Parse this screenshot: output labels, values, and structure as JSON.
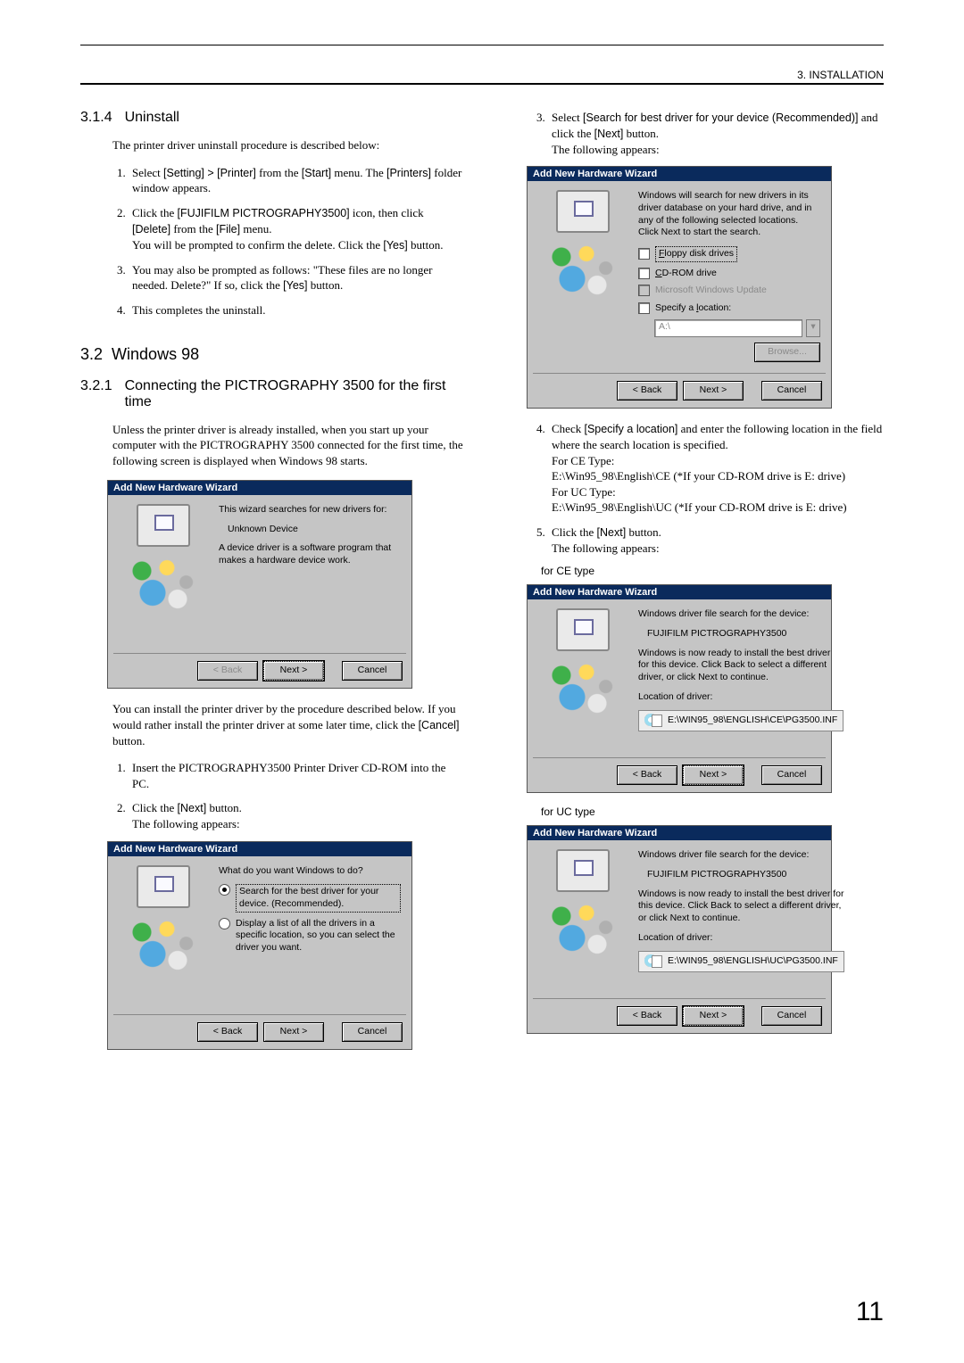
{
  "header": {
    "chapter": "3. INSTALLATION"
  },
  "page_number": "11",
  "left": {
    "sec314": {
      "num": "3.1.4",
      "title": "Uninstall",
      "intro": "The printer driver uninstall procedure is described below:",
      "steps": [
        "Select [Setting] > [Printer] from the [Start] menu. The [Printers] folder window appears.",
        "Click the [FUJIFILM PICTROGRAPHY3500] icon, then click [Delete] from the [File] menu.\nYou will be prompted to confirm the delete. Click the [Yes] button.",
        "You may also be prompted as follows: \"These files are no longer needed. Delete?\" If so, click the [Yes] button.",
        "This completes the uninstall."
      ]
    },
    "sec32": {
      "num": "3.2",
      "title": "Windows 98"
    },
    "sec321": {
      "num": "3.2.1",
      "title": "Connecting the PICTROGRAPHY 3500 for the first time",
      "intro": "Unless the printer driver is already installed, when you start up your computer with the PICTROGRAPHY 3500 connected for the first time, the following screen is displayed when Windows 98 starts.",
      "wiz1": {
        "title": "Add New Hardware Wizard",
        "line1": "This wizard searches for new drivers for:",
        "device": "Unknown Device",
        "line2": "A device driver is a software program that makes a hardware device work.",
        "btn_back": "< Back",
        "btn_next": "Next >",
        "btn_cancel": "Cancel"
      },
      "after_wiz1": "You can install the printer driver by the procedure described below. If you would rather install the printer driver at some later time, click the [Cancel] button.",
      "steps": [
        "Insert the PICTROGRAPHY3500 Printer Driver CD-ROM into the PC.",
        "Click the [Next] button.\nThe following appears:"
      ],
      "wiz2": {
        "title": "Add New Hardware Wizard",
        "question": "What do you want Windows to do?",
        "opt1": "Search for the best driver for your device. (Recommended).",
        "opt2": "Display a list of all the drivers in a specific location, so you can select the driver you want.",
        "btn_back": "< Back",
        "btn_next": "Next >",
        "btn_cancel": "Cancel"
      }
    }
  },
  "right": {
    "step3": {
      "text": "Select [Search for best driver for your device (Recommended)] and click the [Next] button.\nThe following appears:"
    },
    "wiz3": {
      "title": "Add New Hardware Wizard",
      "intro": "Windows will search for new drivers in its driver database on your hard drive, and in any of the following selected locations. Click Next to start the search.",
      "chk_floppy": "Floppy disk drives",
      "chk_cdrom": "CD-ROM drive",
      "chk_wu": "Microsoft Windows Update",
      "chk_loc": "Specify a location:",
      "path_placeholder": "A:\\",
      "btn_browse": "Browse...",
      "btn_back": "< Back",
      "btn_next": "Next >",
      "btn_cancel": "Cancel"
    },
    "step4": {
      "text": "Check [Specify a location] and enter the following location in the field where the search location is specified.",
      "ce_label": "For CE Type:",
      "ce_path": "E:\\Win95_98\\English\\CE (*If your CD-ROM drive is E: drive)",
      "uc_label": "For UC Type:",
      "uc_path": "E:\\Win95_98\\English\\UC (*If your CD-ROM drive is E: drive)"
    },
    "step5": {
      "text": "Click the [Next] button.\nThe following appears:"
    },
    "for_ce": "for CE type",
    "wiz4": {
      "title": "Add New Hardware Wizard",
      "line1": "Windows driver file search for the device:",
      "device": "FUJIFILM PICTROGRAPHY3500",
      "line2": "Windows is now ready to install the best driver for this device. Click Back to select a different driver, or click Next to continue.",
      "loc_label": "Location of driver:",
      "loc_path": "E:\\WIN95_98\\ENGLISH\\CE\\PG3500.INF",
      "btn_back": "< Back",
      "btn_next": "Next >",
      "btn_cancel": "Cancel"
    },
    "for_uc": "for UC type",
    "wiz5": {
      "title": "Add New Hardware Wizard",
      "line1": "Windows driver file search for the device:",
      "device": "FUJIFILM PICTROGRAPHY3500",
      "line2": "Windows is now ready to install the best driver for this device. Click Back to select a different driver, or click Next to continue.",
      "loc_label": "Location of driver:",
      "loc_path": "E:\\WIN95_98\\ENGLISH\\UC\\PG3500.INF",
      "btn_back": "< Back",
      "btn_next": "Next >",
      "btn_cancel": "Cancel"
    }
  }
}
